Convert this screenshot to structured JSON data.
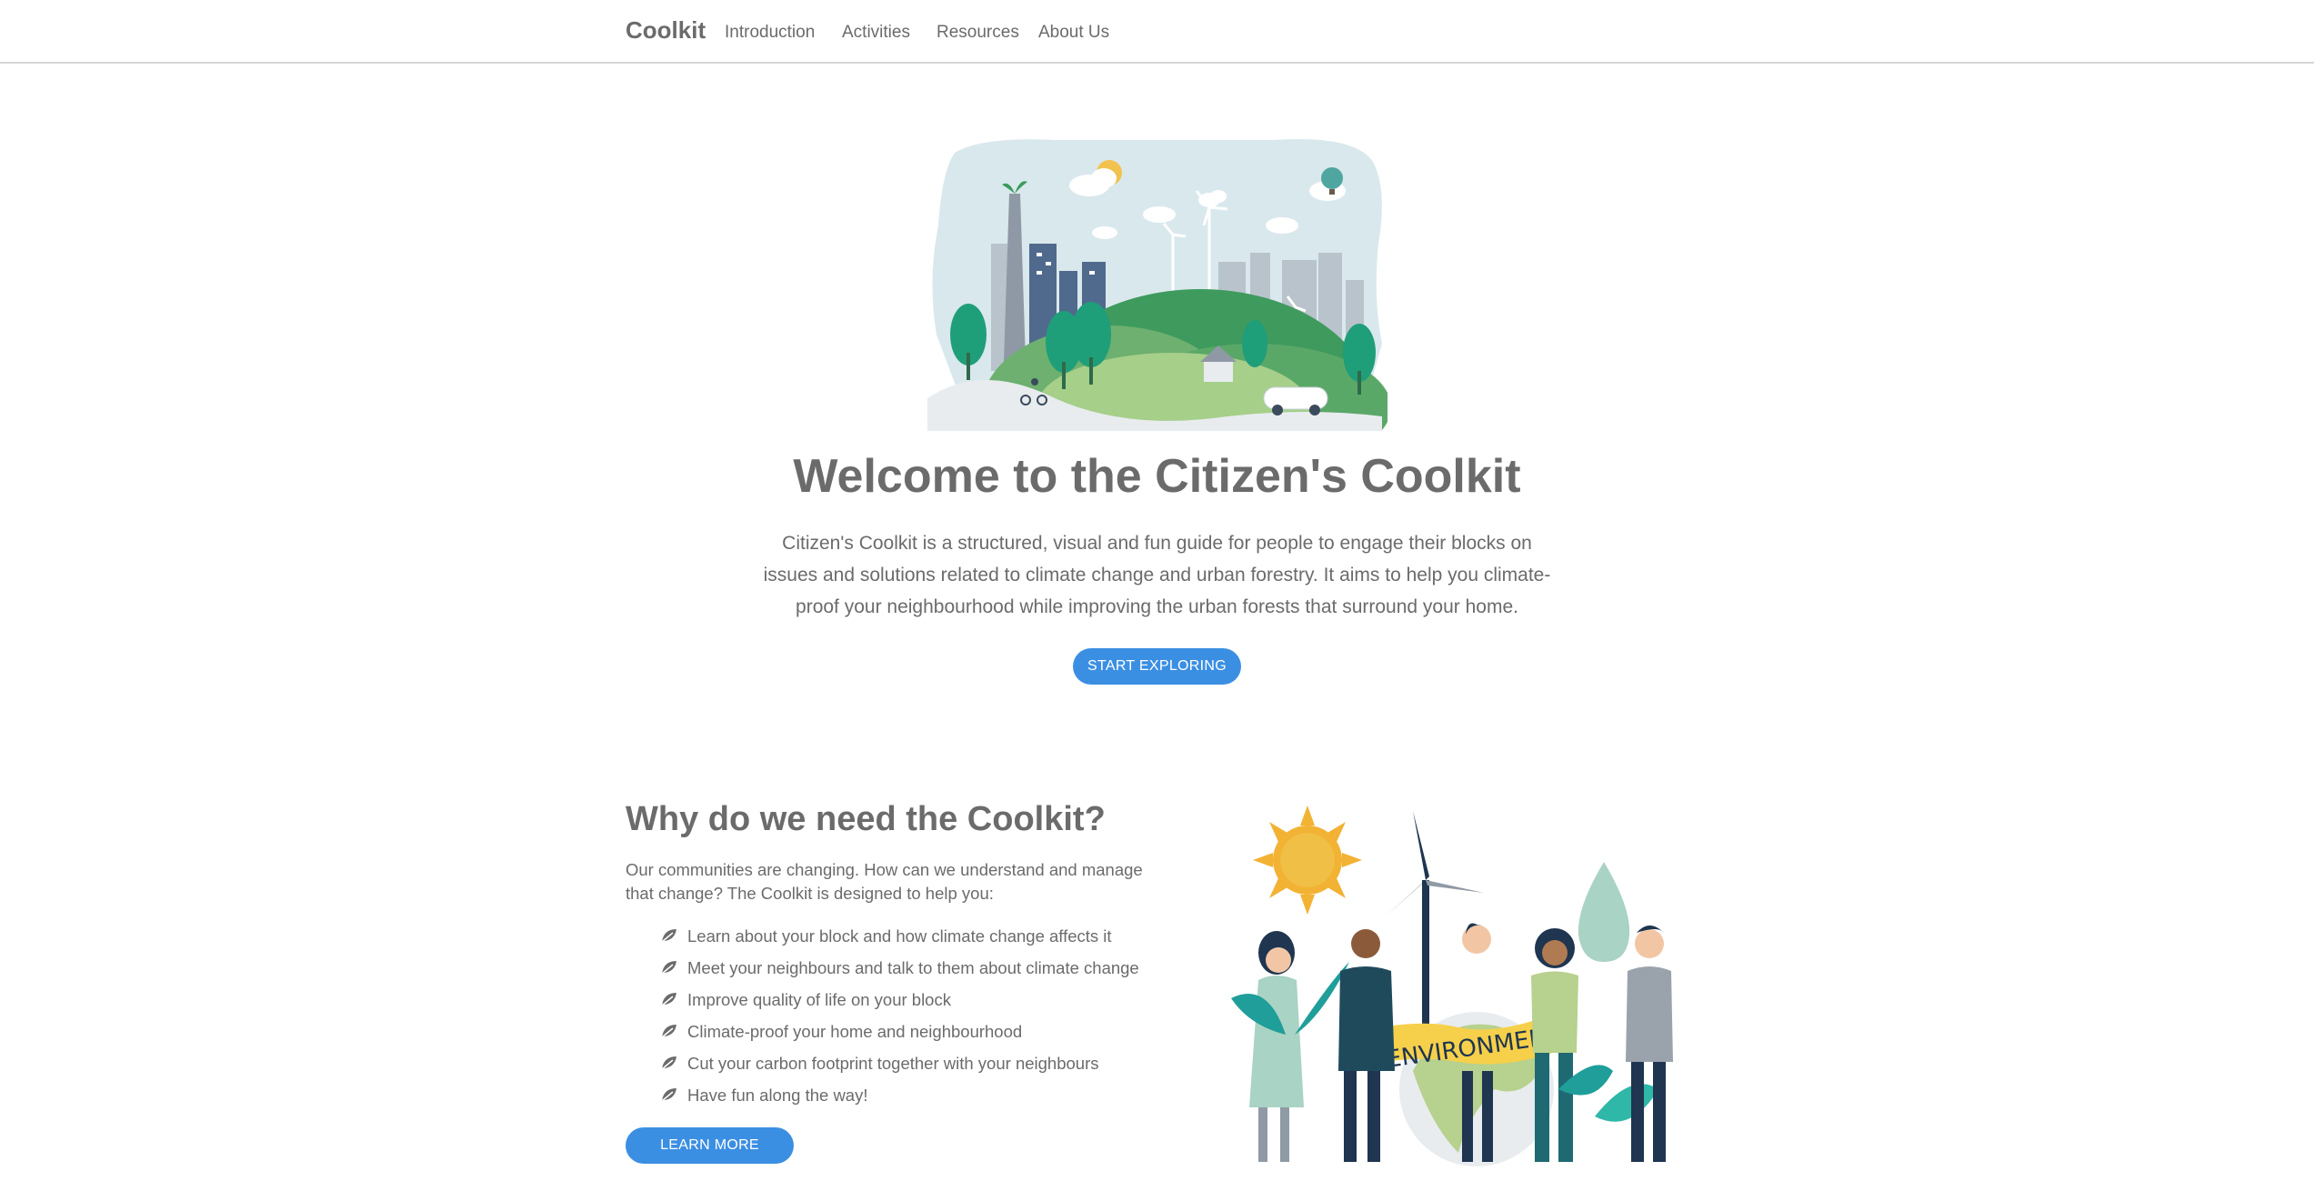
{
  "nav": {
    "brand": "Coolkit",
    "links": [
      "Introduction",
      "Activities",
      "Resources",
      "About Us"
    ]
  },
  "hero": {
    "title": "Welcome to the Citizen's Coolkit",
    "text": "Citizen's Coolkit is a structured, visual and fun guide for people to engage their blocks on issues and solutions related to  climate change and urban forestry. It aims to help you climate-proof your neighbourhood while improving the urban forests that surround your home.",
    "button": "START EXPLORING"
  },
  "why": {
    "title": "Why do we need the Coolkit?",
    "intro": "Our communities are changing. How can we understand and manage that change? The Coolkit is designed to help you:",
    "items": [
      "Learn about your block and how climate change affects it",
      "Meet your neighbours and talk to them about climate change",
      "Improve quality of life on your block",
      "Climate-proof your home and neighbourhood",
      "Cut your carbon footprint together with your neighbours",
      "Have fun along the way!"
    ],
    "button": "LEARN MORE",
    "banner_text": "ENVIRONMENT"
  },
  "icons": {
    "list_bullet": "leaf-icon"
  },
  "colors": {
    "accent": "#3b8fe3",
    "text": "#6b6b6b"
  }
}
